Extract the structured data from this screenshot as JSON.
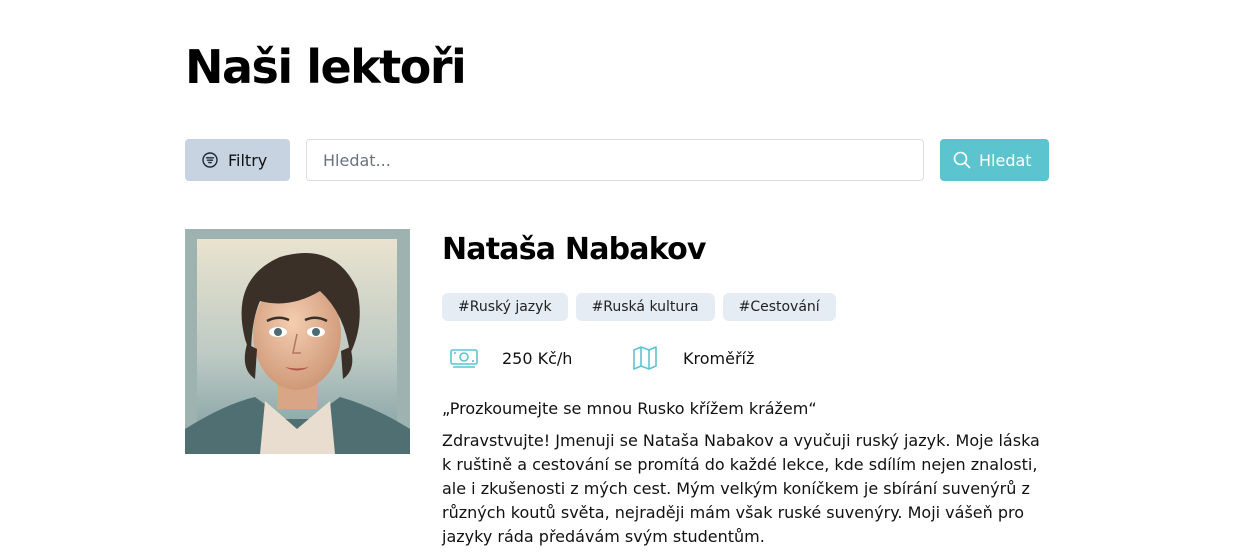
{
  "page": {
    "title": "Naši lektoři"
  },
  "toolbar": {
    "filter_label": "Filtry",
    "search_placeholder": "Hledat...",
    "search_label": "Hledat",
    "colors": {
      "filter_bg": "#c7d3e0",
      "search_bg": "#5bc4cf"
    }
  },
  "tutor": {
    "name": "Nataša Nabakov",
    "tags": [
      "#Ruský jazyk",
      "#Ruská kultura",
      "#Cestování"
    ],
    "price": "250 Kč/h",
    "location": "Kroměříž",
    "motto": "„Prozkoumejte se mnou Rusko křížem krážem“",
    "bio": "Zdravstvujte! Jmenuji se Nataša Nabakov a vyučuji ruský jazyk. Moje láska k ruštině a cestování se promítá do každé lekce, kde sdílím nejen znalosti, ale i zkušenosti z mých cest. Mým velkým koníčkem je sbírání suvenýrů z různých koutů světa, nejraději mám však ruské suvenýry. Moji vášeň pro jazyky ráda předávám svým studentům.",
    "icons": {
      "price": "money-icon",
      "location": "map-icon"
    }
  }
}
